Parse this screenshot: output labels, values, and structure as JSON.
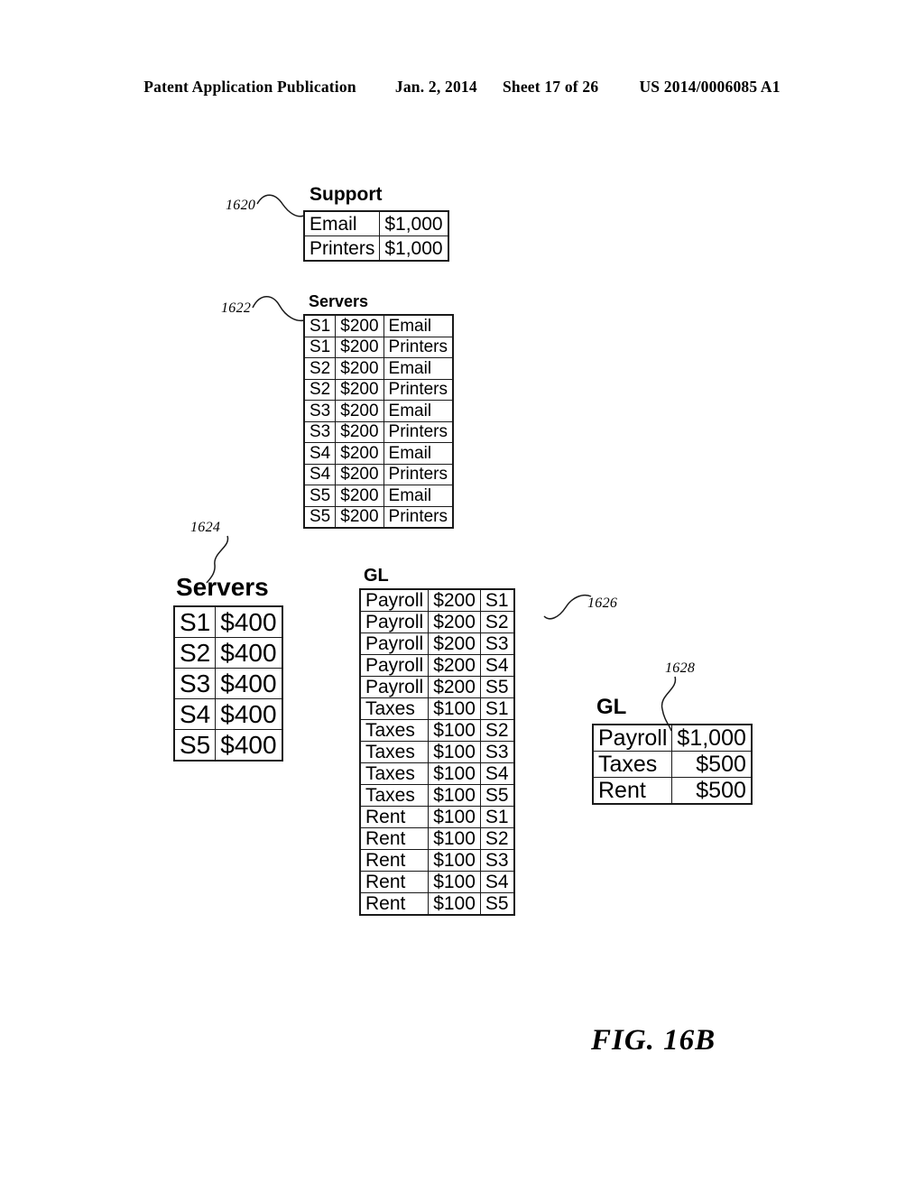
{
  "header": {
    "publication": "Patent Application Publication",
    "date": "Jan. 2, 2014",
    "sheet": "Sheet 17 of 26",
    "patent_number": "US 2014/0006085 A1"
  },
  "figure": {
    "caption": "FIG. 16B"
  },
  "reference_numerals": {
    "support": "1620",
    "servers_detail": "1622",
    "servers_summary": "1624",
    "gl_detail": "1626",
    "gl_summary": "1628"
  },
  "tables": {
    "support": {
      "title": "Support",
      "rows": [
        {
          "label": "Email",
          "amount": "$1,000"
        },
        {
          "label": "Printers",
          "amount": "$1,000"
        }
      ]
    },
    "servers_detail": {
      "title": "Servers",
      "rows": [
        {
          "server": "S1",
          "amount": "$200",
          "dept": "Email"
        },
        {
          "server": "S1",
          "amount": "$200",
          "dept": "Printers"
        },
        {
          "server": "S2",
          "amount": "$200",
          "dept": "Email"
        },
        {
          "server": "S2",
          "amount": "$200",
          "dept": "Printers"
        },
        {
          "server": "S3",
          "amount": "$200",
          "dept": "Email"
        },
        {
          "server": "S3",
          "amount": "$200",
          "dept": "Printers"
        },
        {
          "server": "S4",
          "amount": "$200",
          "dept": "Email"
        },
        {
          "server": "S4",
          "amount": "$200",
          "dept": "Printers"
        },
        {
          "server": "S5",
          "amount": "$200",
          "dept": "Email"
        },
        {
          "server": "S5",
          "amount": "$200",
          "dept": "Printers"
        }
      ]
    },
    "servers_summary": {
      "title": "Servers",
      "rows": [
        {
          "server": "S1",
          "amount": "$400"
        },
        {
          "server": "S2",
          "amount": "$400"
        },
        {
          "server": "S3",
          "amount": "$400"
        },
        {
          "server": "S4",
          "amount": "$400"
        },
        {
          "server": "S5",
          "amount": "$400"
        }
      ]
    },
    "gl_detail": {
      "title": "GL",
      "rows": [
        {
          "account": "Payroll",
          "amount": "$200",
          "server": "S1"
        },
        {
          "account": "Payroll",
          "amount": "$200",
          "server": "S2"
        },
        {
          "account": "Payroll",
          "amount": "$200",
          "server": "S3"
        },
        {
          "account": "Payroll",
          "amount": "$200",
          "server": "S4"
        },
        {
          "account": "Payroll",
          "amount": "$200",
          "server": "S5"
        },
        {
          "account": "Taxes",
          "amount": "$100",
          "server": "S1"
        },
        {
          "account": "Taxes",
          "amount": "$100",
          "server": "S2"
        },
        {
          "account": "Taxes",
          "amount": "$100",
          "server": "S3"
        },
        {
          "account": "Taxes",
          "amount": "$100",
          "server": "S4"
        },
        {
          "account": "Taxes",
          "amount": "$100",
          "server": "S5"
        },
        {
          "account": "Rent",
          "amount": "$100",
          "server": "S1"
        },
        {
          "account": "Rent",
          "amount": "$100",
          "server": "S2"
        },
        {
          "account": "Rent",
          "amount": "$100",
          "server": "S3"
        },
        {
          "account": "Rent",
          "amount": "$100",
          "server": "S4"
        },
        {
          "account": "Rent",
          "amount": "$100",
          "server": "S5"
        }
      ]
    },
    "gl_summary": {
      "title": "GL",
      "rows": [
        {
          "account": "Payroll",
          "amount": "$1,000"
        },
        {
          "account": "Taxes",
          "amount": "$500"
        },
        {
          "account": "Rent",
          "amount": "$500"
        }
      ]
    }
  },
  "colors": {
    "ink": "#1a1a1a",
    "page": "#ffffff"
  }
}
